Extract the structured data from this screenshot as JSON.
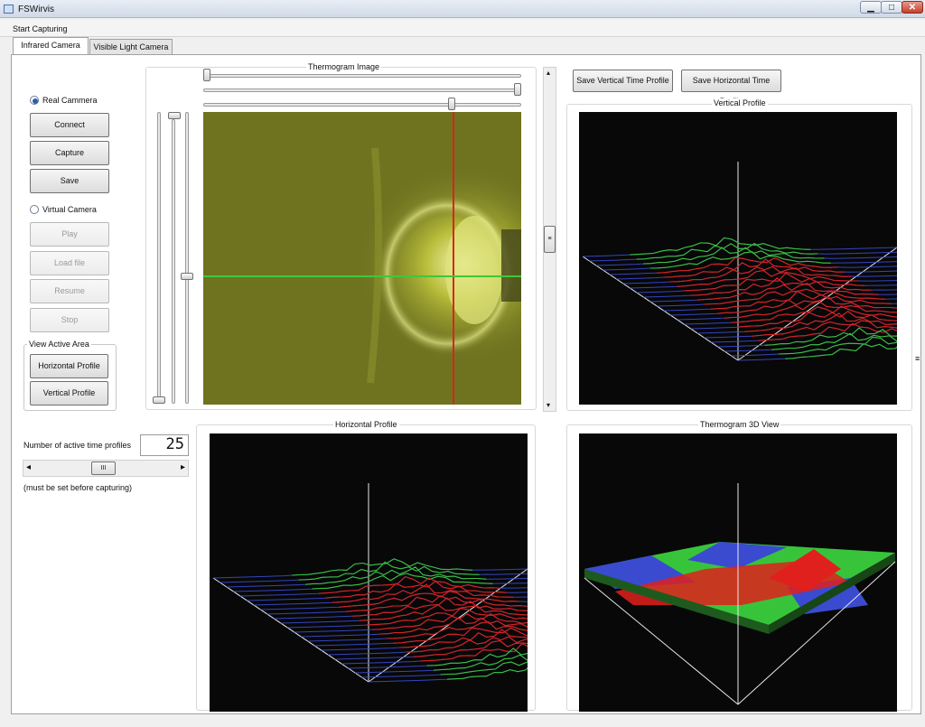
{
  "window": {
    "title": "FSWirvis",
    "minimize_glyph": "▁",
    "maximize_glyph": "□",
    "close_glyph": "✕"
  },
  "menu": {
    "start_capturing": "Start Capturing"
  },
  "tabs": [
    {
      "label": "Infrared Camera"
    },
    {
      "label": "Visible Light Camera"
    }
  ],
  "camera": {
    "real_label": "Real Cammera",
    "connect": "Connect",
    "capture": "Capture",
    "save": "Save",
    "virtual_label": "Virtual Camera",
    "play": "Play",
    "load_file": "Load file",
    "resume": "Resume",
    "stop": "Stop",
    "selected_mode": "Real Cammera"
  },
  "active_area": {
    "group_title": "View Active Area",
    "horizontal": "Horizontal Profile",
    "vertical": "Vertical Profile"
  },
  "profiles_setting": {
    "label": "Number of active time profiles",
    "value": "25",
    "note": "(must be set before capturing)",
    "scroll_glyph": "III"
  },
  "thermogram": {
    "title": "Thermogram Image"
  },
  "toolbar": {
    "save_vertical": "Save Vertical Time Profile",
    "save_horizontal": "Save Horizontal Time Profile"
  },
  "plots": {
    "vertical": "Vertical Profile",
    "horizontal": "Horizontal Profile",
    "view3d": "Thermogram 3D View"
  },
  "colors": {
    "red_trace": "#e0201c",
    "blue_trace": "#3a4bd0",
    "green_trace": "#38c43a",
    "crosshair_red": "#d8261c",
    "crosshair_green": "#3cc83c"
  }
}
